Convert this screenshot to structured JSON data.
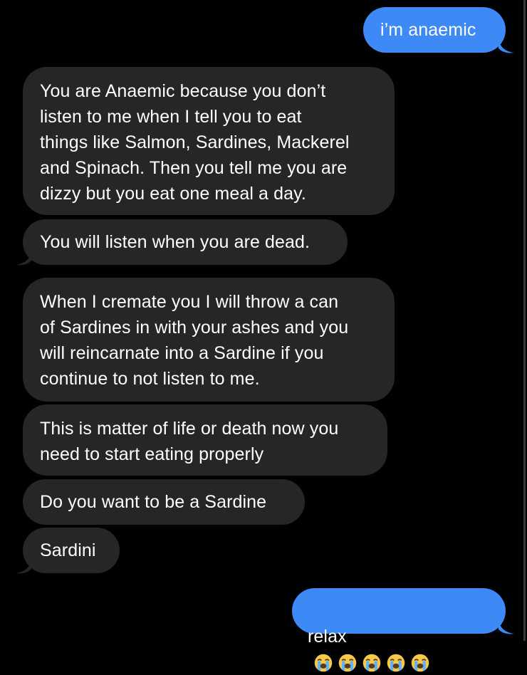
{
  "conversation": {
    "messages": [
      {
        "id": "m1",
        "sender": "me",
        "text": "i’m anaemic"
      },
      {
        "id": "m2",
        "sender": "them",
        "text": "You are Anaemic because you don’t\nlisten to me when I tell you to eat\nthings like Salmon, Sardines, Mackerel\nand Spinach. Then you tell me you are\ndizzy but you eat one meal a day."
      },
      {
        "id": "m3",
        "sender": "them",
        "text": "You will listen when you are dead."
      },
      {
        "id": "m4",
        "sender": "them",
        "text": "When I cremate you I will throw a can\nof Sardines in with your ashes and you\nwill reincarnate into a Sardine if you\ncontinue to not listen to me."
      },
      {
        "id": "m5",
        "sender": "them",
        "text": "This is matter of life or death now you\nneed to start eating properly"
      },
      {
        "id": "m6",
        "sender": "them",
        "text": "Do you want to be a Sardine"
      },
      {
        "id": "m7",
        "sender": "them",
        "text": "Sardini"
      },
      {
        "id": "m8",
        "sender": "me",
        "text": "relax",
        "emoji": [
          "loudly-crying-face",
          "loudly-crying-face",
          "loudly-crying-face",
          "loudly-crying-face",
          "loudly-crying-face"
        ]
      }
    ]
  },
  "colors": {
    "background": "#000000",
    "incoming_bubble": "#262628",
    "outgoing_bubble": "#3d8af7",
    "text": "#ffffff"
  }
}
